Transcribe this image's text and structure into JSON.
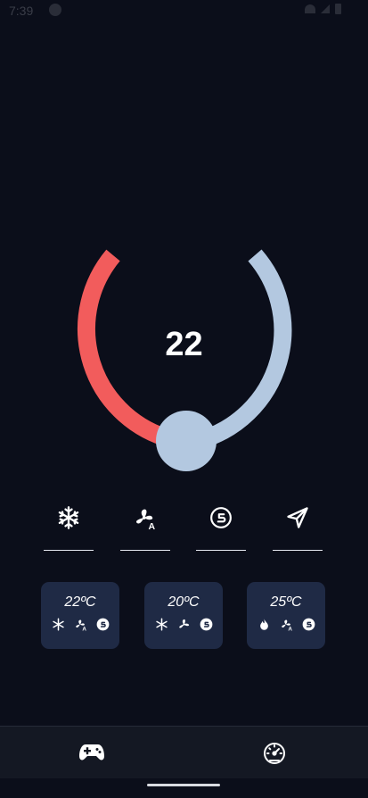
{
  "status_bar": {
    "time": "7:39"
  },
  "thermostat": {
    "temperature": "22",
    "colors": {
      "heat_arc": "#f25c5c",
      "cool_arc": "#b3c8e0",
      "knob": "#b3c8e0"
    }
  },
  "modes": [
    {
      "name": "cool",
      "icon": "snowflake-icon",
      "active": false
    },
    {
      "name": "fan-auto",
      "icon": "fan-auto-icon",
      "active": false
    },
    {
      "name": "eco",
      "icon": "s-circle-icon",
      "active": false
    },
    {
      "name": "direction",
      "icon": "send-icon",
      "active": false
    }
  ],
  "presets": [
    {
      "temperature": "22ºC",
      "icons": [
        "snowflake-icon",
        "fan-auto-icon",
        "s-circle-icon"
      ]
    },
    {
      "temperature": "20ºC",
      "icons": [
        "snowflake-icon",
        "fan-icon",
        "s-circle-icon"
      ]
    },
    {
      "temperature": "25ºC",
      "icons": [
        "flame-icon",
        "fan-auto-icon",
        "s-circle-icon"
      ]
    }
  ],
  "bottom_nav": [
    {
      "icon": "gamepad-icon"
    },
    {
      "icon": "speedometer-icon"
    }
  ]
}
